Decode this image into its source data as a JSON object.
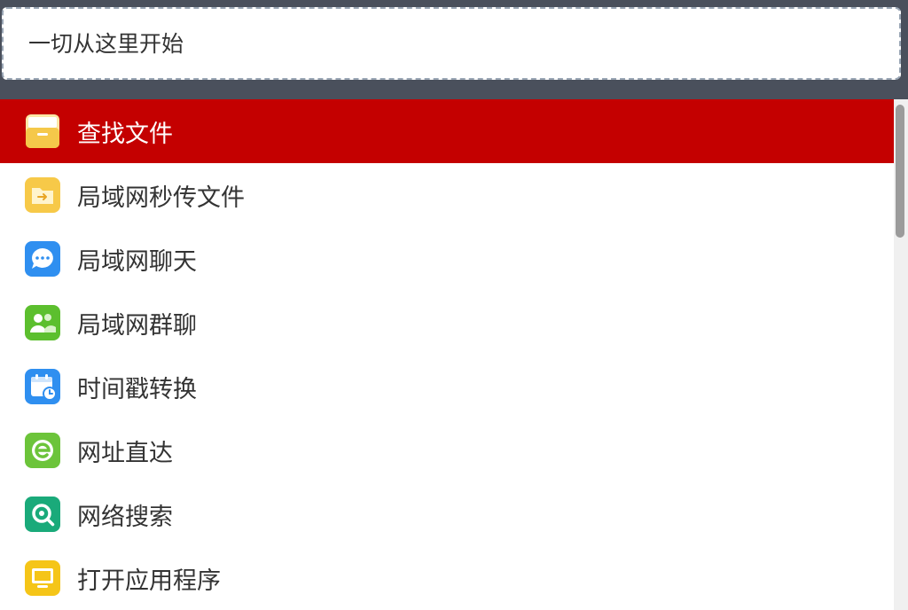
{
  "search": {
    "placeholder": "一切从这里开始"
  },
  "results": [
    {
      "label": "查找文件",
      "icon": "file-cabinet-icon",
      "color": "#f5c84a",
      "selected": true
    },
    {
      "label": "局域网秒传文件",
      "icon": "folder-transfer-icon",
      "color": "#f7c948",
      "selected": false
    },
    {
      "label": "局域网聊天",
      "icon": "chat-bubble-icon",
      "color": "#2f8ff0",
      "selected": false
    },
    {
      "label": "局域网群聊",
      "icon": "group-users-icon",
      "color": "#5cbf2e",
      "selected": false
    },
    {
      "label": "时间戳转换",
      "icon": "calendar-clock-icon",
      "color": "#2f8ff0",
      "selected": false
    },
    {
      "label": "网址直达",
      "icon": "browser-e-icon",
      "color": "#6cc43a",
      "selected": false
    },
    {
      "label": "网络搜索",
      "icon": "web-search-icon",
      "color": "#1aaa7a",
      "selected": false
    },
    {
      "label": "打开应用程序",
      "icon": "monitor-app-icon",
      "color": "#f5c518",
      "selected": false
    }
  ],
  "colors": {
    "selected_bg": "#c40000",
    "backdrop": "#4a505c"
  }
}
